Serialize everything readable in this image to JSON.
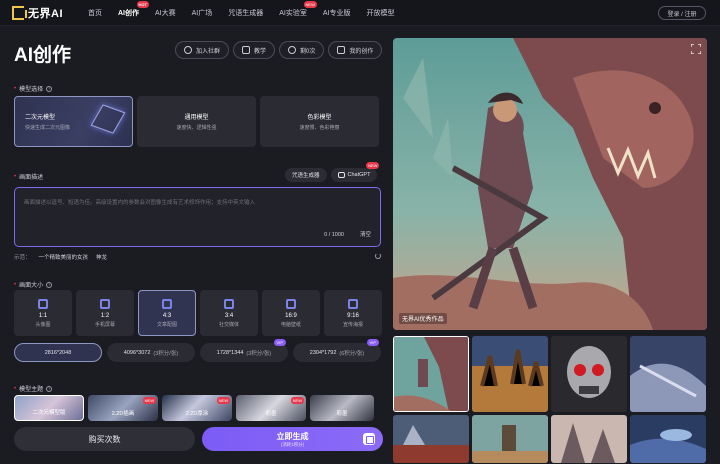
{
  "nav": {
    "logo": "无界AI",
    "items": [
      {
        "label": "首页",
        "active": false,
        "badge": ""
      },
      {
        "label": "AI创作",
        "active": true,
        "badge": "HOT"
      },
      {
        "label": "AI大赛",
        "active": false,
        "badge": ""
      },
      {
        "label": "AI广场",
        "active": false,
        "badge": ""
      },
      {
        "label": "咒语生成器",
        "active": false,
        "badge": ""
      },
      {
        "label": "AI实验室",
        "active": false,
        "badge": "NEW"
      },
      {
        "label": "AI专业版",
        "active": false,
        "badge": ""
      },
      {
        "label": "开放模型",
        "active": false,
        "badge": ""
      }
    ],
    "login": "登录 / 注册"
  },
  "page": {
    "title": "AI创作",
    "actions": [
      "加入社群",
      "教学",
      "剩0次",
      "我的创作"
    ]
  },
  "model_select": {
    "label": "模型选择",
    "cards": [
      {
        "name": "二次元模型",
        "desc": "快速生成二次元图像",
        "active": true
      },
      {
        "name": "通用模型",
        "desc": "速度快、逻辑性强",
        "active": false
      },
      {
        "name": "色彩模型",
        "desc": "速度慢、色彩艳丽",
        "active": false
      }
    ]
  },
  "prompt": {
    "label": "画面描述",
    "tags": [
      {
        "label": "咒语生成器",
        "badge": ""
      },
      {
        "label": "ChatGPT",
        "badge": "NEW"
      }
    ],
    "placeholder": "画面描述以逗号、短语为佳。高级设置内的参数会对图像生成有艺术修饰作用；支持中英文输入",
    "count": "0 / 1000",
    "clear": "清空",
    "example_label": "示范：",
    "example_items": [
      "一个精致美丽的女孩",
      "神龙"
    ]
  },
  "size": {
    "label": "画面大小",
    "ratios": [
      {
        "num": "1:1",
        "name": "头像图",
        "active": false
      },
      {
        "num": "1:2",
        "name": "手机屏幕",
        "active": false
      },
      {
        "num": "4:3",
        "name": "文章配图",
        "active": true
      },
      {
        "num": "3:4",
        "name": "社交媒体",
        "active": false
      },
      {
        "num": "16:9",
        "name": "电脑壁纸",
        "active": false
      },
      {
        "num": "9:16",
        "name": "宣传海报",
        "active": false
      }
    ],
    "resolutions": [
      {
        "label": "2816*2048",
        "pts": "",
        "active": true,
        "badge": ""
      },
      {
        "label": "4096*3072",
        "pts": "(3积分/张)",
        "active": false,
        "badge": ""
      },
      {
        "label": "1728*1344",
        "pts": "(3积分/张)",
        "active": false,
        "badge": "VIP"
      },
      {
        "label": "2304*1792",
        "pts": "(6积分/张)",
        "active": false,
        "badge": "VIP"
      }
    ]
  },
  "theme": {
    "label": "模型主题",
    "items": [
      {
        "label": "二次元模型版",
        "badge": ""
      },
      {
        "label": "2.2D插画",
        "badge": "NEW"
      },
      {
        "label": "2.2D厚涂",
        "badge": "NEW"
      },
      {
        "label": "彩墨",
        "badge": "NEW"
      },
      {
        "label": "彩墨",
        "badge": ""
      }
    ]
  },
  "bottom": {
    "buy": "购买次数",
    "generate": "立即生成",
    "generate_sub": "(消耗1积分)"
  },
  "hero": {
    "caption": "无界AI优秀作品"
  },
  "colors": {
    "accent": "#7b5cf5",
    "hot_badge": "#e8394b",
    "background": "#1b1c22"
  }
}
